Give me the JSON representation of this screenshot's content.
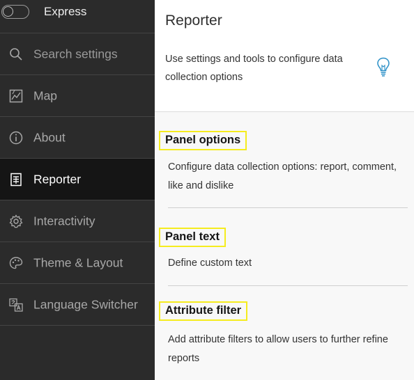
{
  "sidebar": {
    "express": {
      "label": "Express",
      "toggle_on": false
    },
    "search": {
      "placeholder": "Search settings"
    },
    "items": [
      {
        "label": "Map",
        "icon": "map-icon",
        "active": false
      },
      {
        "label": "About",
        "icon": "info-icon",
        "active": false
      },
      {
        "label": "Reporter",
        "icon": "reporter-icon",
        "active": true
      },
      {
        "label": "Interactivity",
        "icon": "gear-icon",
        "active": false
      },
      {
        "label": "Theme & Layout",
        "icon": "palette-icon",
        "active": false
      },
      {
        "label": "Language Switcher",
        "icon": "language-icon",
        "active": false
      }
    ]
  },
  "main": {
    "title": "Reporter",
    "description": "Use settings and tools to configure data collection options",
    "sections": [
      {
        "title": "Panel options",
        "description": "Configure data collection options: report, comment, like and dislike"
      },
      {
        "title": "Panel text",
        "description": "Define custom text"
      },
      {
        "title": "Attribute filter",
        "description": "Add attribute filters to allow users to further refine reports"
      }
    ]
  },
  "colors": {
    "sidebar_bg": "#2b2b2b",
    "sidebar_active_bg": "#151515",
    "highlight": "#f5ec1e",
    "bulb": "#2a8fc7"
  }
}
